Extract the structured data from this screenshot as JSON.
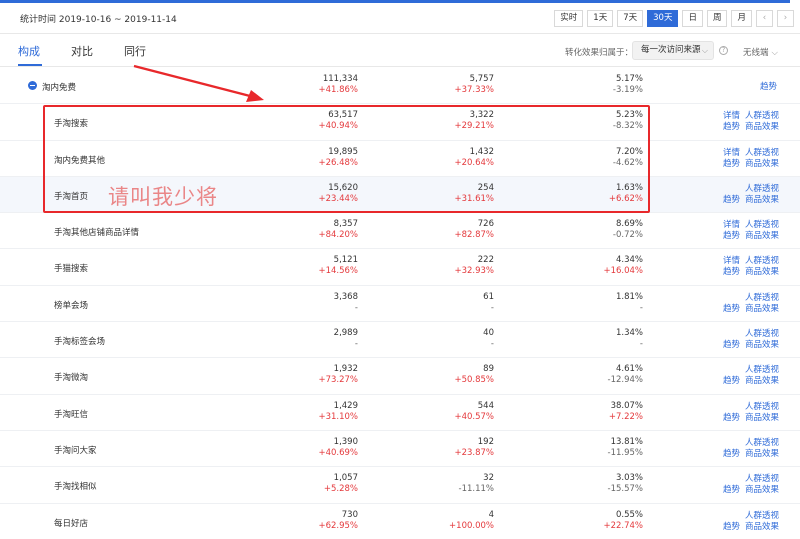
{
  "header": {
    "stat_time": "统计时间 2019-10-16 ~ 2019-11-14",
    "ranges": [
      "实时",
      "1天",
      "7天",
      "30天",
      "日",
      "周",
      "月"
    ],
    "active_range": "30天",
    "prev_icon": "chevron-left-icon",
    "next_icon": "chevron-right-icon"
  },
  "tabs": [
    {
      "label": "构成"
    },
    {
      "label": "对比"
    },
    {
      "label": "同行"
    }
  ],
  "filters": {
    "attribution_label": "转化效果归属于：",
    "attribution_value": "每一次访问来源",
    "help_icon": "question-circle-icon",
    "device_label": "无线端"
  },
  "colors": {
    "accent": "#2f6bd8",
    "up": "#e4393c",
    "highlight_box": "#e8282b"
  },
  "parent_row": {
    "name": "淘内免费",
    "m1": {
      "v": "111,334",
      "c": "+41.86%"
    },
    "m2": {
      "v": "5,757",
      "c": "+37.33%"
    },
    "m3": {
      "v": "5.17%",
      "c": "-3.19%"
    },
    "action": "趋势"
  },
  "action_labels": {
    "detail": "详情",
    "crowd": "人群透视",
    "trend": "趋势",
    "goods": "商品效果"
  },
  "rows": [
    {
      "name": "手淘搜索",
      "m1": {
        "v": "63,517",
        "c": "+40.94%"
      },
      "m2": {
        "v": "3,322",
        "c": "+29.21%"
      },
      "m3": {
        "v": "5.23%",
        "c": "-8.32%"
      },
      "detail": true
    },
    {
      "name": "淘内免费其他",
      "m1": {
        "v": "19,895",
        "c": "+26.48%"
      },
      "m2": {
        "v": "1,432",
        "c": "+20.64%"
      },
      "m3": {
        "v": "7.20%",
        "c": "-4.62%"
      },
      "detail": true
    },
    {
      "name": "手淘首页",
      "m1": {
        "v": "15,620",
        "c": "+23.44%"
      },
      "m2": {
        "v": "254",
        "c": "+31.61%"
      },
      "m3": {
        "v": "1.63%",
        "c": "+6.62%"
      },
      "detail": false
    },
    {
      "name": "手淘其他店铺商品详情",
      "m1": {
        "v": "8,357",
        "c": "+84.20%"
      },
      "m2": {
        "v": "726",
        "c": "+82.87%"
      },
      "m3": {
        "v": "8.69%",
        "c": "-0.72%"
      },
      "detail": true
    },
    {
      "name": "手猫搜索",
      "m1": {
        "v": "5,121",
        "c": "+14.56%"
      },
      "m2": {
        "v": "222",
        "c": "+32.93%"
      },
      "m3": {
        "v": "4.34%",
        "c": "+16.04%"
      },
      "detail": true
    },
    {
      "name": "榜单会场",
      "m1": {
        "v": "3,368",
        "c": "-"
      },
      "m2": {
        "v": "61",
        "c": "-"
      },
      "m3": {
        "v": "1.81%",
        "c": "-"
      },
      "detail": false
    },
    {
      "name": "手淘标签会场",
      "m1": {
        "v": "2,989",
        "c": "-"
      },
      "m2": {
        "v": "40",
        "c": "-"
      },
      "m3": {
        "v": "1.34%",
        "c": "-"
      },
      "detail": false
    },
    {
      "name": "手淘微淘",
      "m1": {
        "v": "1,932",
        "c": "+73.27%"
      },
      "m2": {
        "v": "89",
        "c": "+50.85%"
      },
      "m3": {
        "v": "4.61%",
        "c": "-12.94%"
      },
      "detail": false
    },
    {
      "name": "手淘旺信",
      "m1": {
        "v": "1,429",
        "c": "+31.10%"
      },
      "m2": {
        "v": "544",
        "c": "+40.57%"
      },
      "m3": {
        "v": "38.07%",
        "c": "+7.22%"
      },
      "detail": false
    },
    {
      "name": "手淘问大家",
      "m1": {
        "v": "1,390",
        "c": "+40.69%"
      },
      "m2": {
        "v": "192",
        "c": "+23.87%"
      },
      "m3": {
        "v": "13.81%",
        "c": "-11.95%"
      },
      "detail": false
    },
    {
      "name": "手淘找相似",
      "m1": {
        "v": "1,057",
        "c": "+5.28%"
      },
      "m2": {
        "v": "32",
        "c": "-11.11%"
      },
      "m3": {
        "v": "3.03%",
        "c": "-15.57%"
      },
      "detail": false
    },
    {
      "name": "每日好店",
      "m1": {
        "v": "730",
        "c": "+62.95%"
      },
      "m2": {
        "v": "4",
        "c": "+100.00%"
      },
      "m3": {
        "v": "0.55%",
        "c": "+22.74%"
      },
      "detail": false
    }
  ],
  "watermark": "请叫我少将"
}
